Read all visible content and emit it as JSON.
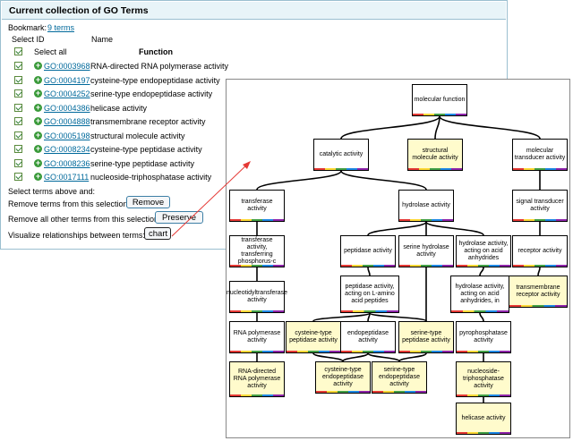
{
  "panel": {
    "title": "Current collection of GO Terms",
    "bookmark_label": "Bookmark:",
    "bookmark_link": "9 terms",
    "col_select_id": "Select ID",
    "col_name": "Name",
    "select_all": "Select all",
    "col_function": "Function",
    "terms": [
      {
        "id": "GO:0003968",
        "name": "RNA-directed RNA polymerase activity"
      },
      {
        "id": "GO:0004197",
        "name": "cysteine-type endopeptidase activity"
      },
      {
        "id": "GO:0004252",
        "name": "serine-type endopeptidase activity"
      },
      {
        "id": "GO:0004386",
        "name": "helicase activity"
      },
      {
        "id": "GO:0004888",
        "name": "transmembrane receptor activity"
      },
      {
        "id": "GO:0005198",
        "name": "structural molecule activity"
      },
      {
        "id": "GO:0008234",
        "name": "cysteine-type peptidase activity"
      },
      {
        "id": "GO:0008236",
        "name": "serine-type peptidase activity"
      },
      {
        "id": "GO:0017111",
        "name": "nucleoside-triphosphatase activity"
      }
    ],
    "select_above": "Select terms above and:",
    "remove_text": "Remove terms from this selection:",
    "remove_btn": "Remove",
    "preserve_text": "Remove all other terms from this selection:",
    "preserve_btn": "Preserve",
    "visualize_text": "Visualize relationships between terms:",
    "chart_btn": "chart"
  },
  "colors": {
    "accent": "#00699b",
    "selected_node": "#fffbcc",
    "arrow": "#e53935"
  },
  "graph": {
    "nodes": [
      {
        "id": "mf",
        "label": "molecular function",
        "sel": false
      },
      {
        "id": "cat",
        "label": "catalytic activity",
        "sel": false
      },
      {
        "id": "struct",
        "label": "structural molecule activity",
        "sel": true
      },
      {
        "id": "trans",
        "label": "molecular transducer activity",
        "sel": false
      },
      {
        "id": "transf",
        "label": "transferase activity",
        "sel": false
      },
      {
        "id": "hydro",
        "label": "hydrolase activity",
        "sel": false
      },
      {
        "id": "sig",
        "label": "signal transducer activity",
        "sel": false
      },
      {
        "id": "transfp",
        "label": "transferase activity, transferring phosphorus-c",
        "sel": false
      },
      {
        "id": "pept",
        "label": "peptidase activity",
        "sel": false
      },
      {
        "id": "serh",
        "label": "serine hydrolase activity",
        "sel": false
      },
      {
        "id": "hacid",
        "label": "hydrolase activity, acting on acid anhydrides",
        "sel": false
      },
      {
        "id": "recep",
        "label": "receptor activity",
        "sel": false
      },
      {
        "id": "nucl",
        "label": "nucleotidyltransferase activity",
        "sel": false
      },
      {
        "id": "peptl",
        "label": "peptidase activity, acting on L-amino acid peptides",
        "sel": false
      },
      {
        "id": "hacidin",
        "label": "hydrolase activity, acting on acid anhydrides, in",
        "sel": false
      },
      {
        "id": "tmr",
        "label": "transmembrane receptor activity",
        "sel": true
      },
      {
        "id": "rnap",
        "label": "RNA polymerase activity",
        "sel": false
      },
      {
        "id": "cystp",
        "label": "cysteine-type peptidase activity",
        "sel": true
      },
      {
        "id": "endo",
        "label": "endopeptidase activity",
        "sel": false
      },
      {
        "id": "serp",
        "label": "serine-type peptidase activity",
        "sel": true
      },
      {
        "id": "pyro",
        "label": "pyrophosphatase activity",
        "sel": false
      },
      {
        "id": "rdrp",
        "label": "RNA-directed RNA polymerase activity",
        "sel": true
      },
      {
        "id": "cyse",
        "label": "cysteine-type endopeptidase activity",
        "sel": true
      },
      {
        "id": "sere",
        "label": "serine-type endopeptidase activity",
        "sel": true
      },
      {
        "id": "ntp",
        "label": "nucleoside-triphosphatase activity",
        "sel": true
      },
      {
        "id": "heli",
        "label": "helicase activity",
        "sel": true
      }
    ]
  }
}
